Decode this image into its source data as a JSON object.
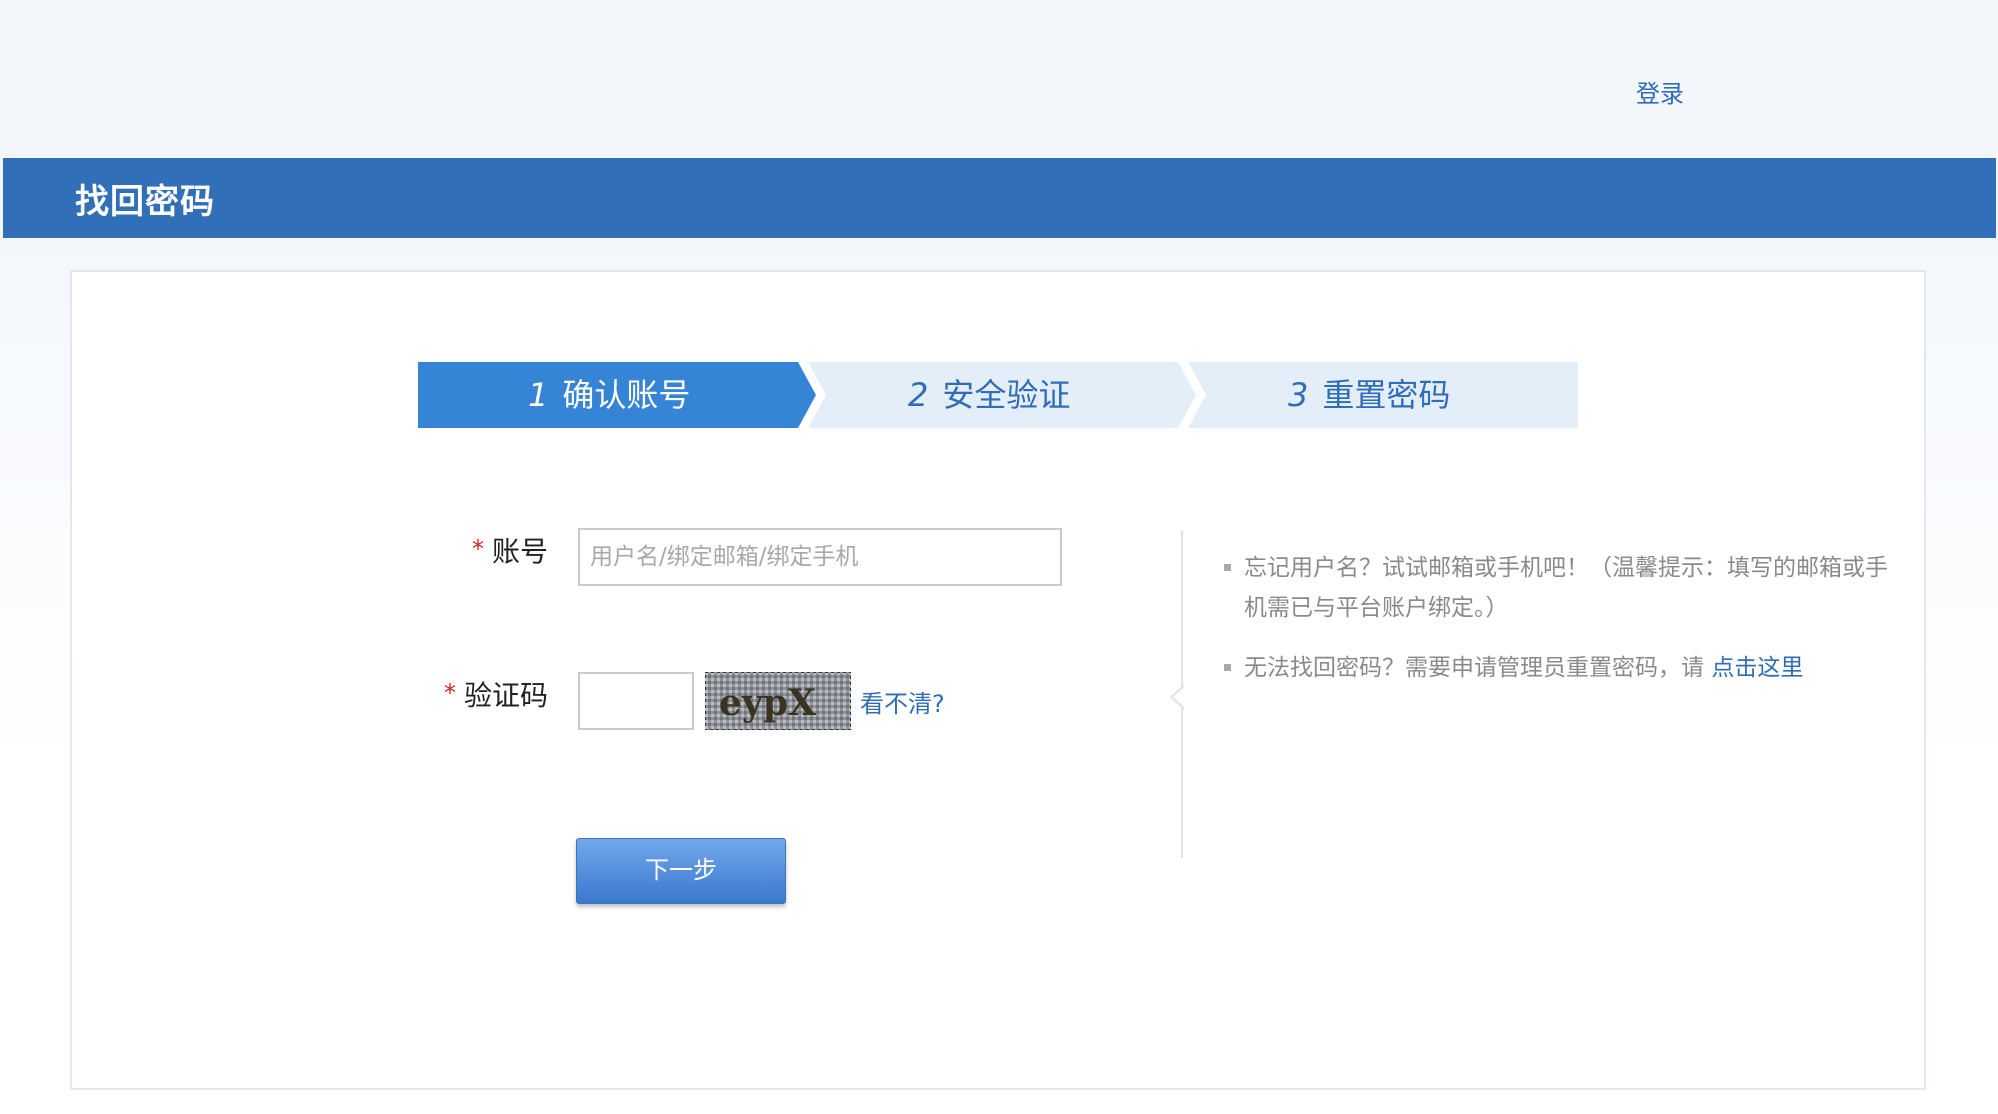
{
  "header": {
    "login_link": "登录",
    "title": "找回密码"
  },
  "steps": [
    {
      "number": "1",
      "label": "确认账号",
      "active": true
    },
    {
      "number": "2",
      "label": "安全验证",
      "active": false
    },
    {
      "number": "3",
      "label": "重置密码",
      "active": false
    }
  ],
  "form": {
    "required_mark": "*",
    "account_label": "账号",
    "account_placeholder": "用户名/绑定邮箱/绑定手机",
    "account_value": "",
    "captcha_label": "验证码",
    "captcha_value": "",
    "captcha_image_text": "eypX",
    "captcha_refresh": "看不清?",
    "next_button": "下一步"
  },
  "tips": {
    "tip1": "忘记用户名？试试邮箱或手机吧！（温馨提示：填写的邮箱或手机需已与平台账户绑定。）",
    "tip2_text": "无法找回密码？需要申请管理员重置密码，请 ",
    "tip2_link": "点击这里"
  },
  "colors": {
    "brand_blue": "#316fb9",
    "step_active": "#3584d6",
    "step_inactive": "#e4eef9",
    "link": "#2f6db8",
    "required": "#d0261f"
  }
}
